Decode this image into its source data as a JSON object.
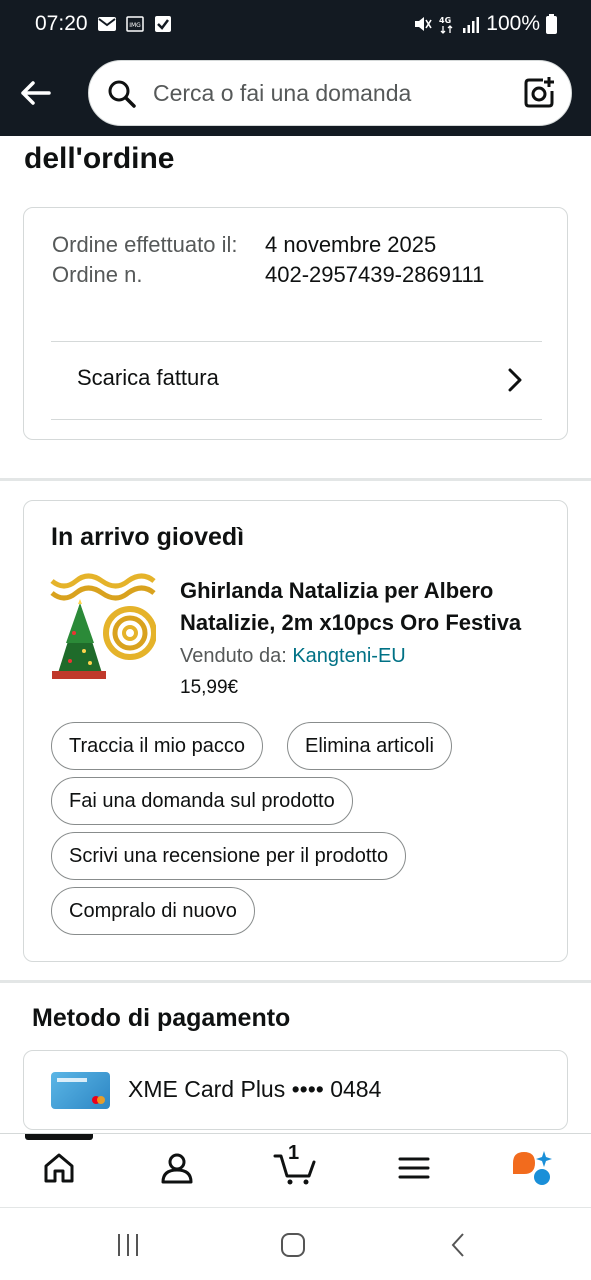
{
  "status_bar": {
    "time": "07:20",
    "battery": "100%",
    "network": "4G"
  },
  "header": {
    "search_placeholder": "Cerca o fai una domanda",
    "icons": [
      "back-arrow-icon",
      "search-icon",
      "camera-icon"
    ]
  },
  "page": {
    "title": "dell'ordine"
  },
  "order_info": {
    "date_label": "Ordine effettuato il:",
    "date_value": "4 novembre 2025",
    "number_label": "Ordine n.",
    "number_value": "402-2957439-2869111",
    "invoice_label": "Scarica fattura"
  },
  "delivery": {
    "title": "In arrivo giovedì",
    "product": {
      "title_line1": "Ghirlanda Natalizia per Albero",
      "title_line2": "Natalizie, 2m x10pcs Oro Festiva",
      "seller_label": "Venduto da:",
      "seller_name": "Kangteni-EU",
      "price": "15,99€"
    },
    "actions": {
      "track": "Traccia il mio pacco",
      "delete": "Elimina articoli",
      "question": "Fai una domanda sul prodotto",
      "review": "Scrivi una recensione per il prodotto",
      "buy_again": "Compralo di nuovo"
    }
  },
  "payment": {
    "title": "Metodo di pagamento",
    "card_label": "XME Card Plus •••• 0484"
  },
  "bottom_nav": {
    "cart_count": "1",
    "items": [
      "home-icon",
      "account-icon",
      "cart-icon",
      "menu-icon",
      "rufus-icon"
    ]
  },
  "colors": {
    "header_bg": "#131a22",
    "link": "#007185",
    "border": "#d5d9d9",
    "text": "#0f1111",
    "secondary_text": "#565959"
  }
}
